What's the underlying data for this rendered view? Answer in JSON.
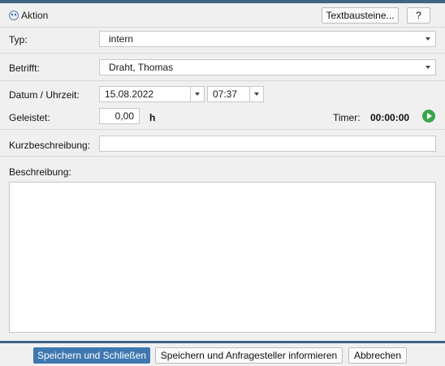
{
  "header": {
    "title": "Aktion",
    "textbausteine_label": "Textbausteine...",
    "help_label": "?"
  },
  "form": {
    "typ_label": "Typ:",
    "typ_value": "intern",
    "betrifft_label": "Betrifft:",
    "betrifft_value": "Draht, Thomas",
    "datum_label": "Datum / Uhrzeit:",
    "datum_value": "15.08.2022",
    "uhrzeit_value": "07:37",
    "geleistet_label": "Geleistet:",
    "geleistet_value": "0,00",
    "geleistet_unit": "h",
    "timer_label": "Timer:",
    "timer_value": "00:00:00",
    "kurz_label": "Kurzbeschreibung:",
    "kurz_value": "",
    "beschreibung_label": "Beschreibung:",
    "beschreibung_value": ""
  },
  "footer": {
    "save_close_label": "Speichern und Schließen",
    "save_inform_label": "Speichern und Anfragesteller informieren",
    "cancel_label": "Abbrechen"
  },
  "colors": {
    "accent": "#3f6486",
    "primary_button": "#3f78b0",
    "timer_play": "#3aa64c"
  },
  "icons": {
    "header_icon": "aktion-icon",
    "play": "play-icon"
  }
}
